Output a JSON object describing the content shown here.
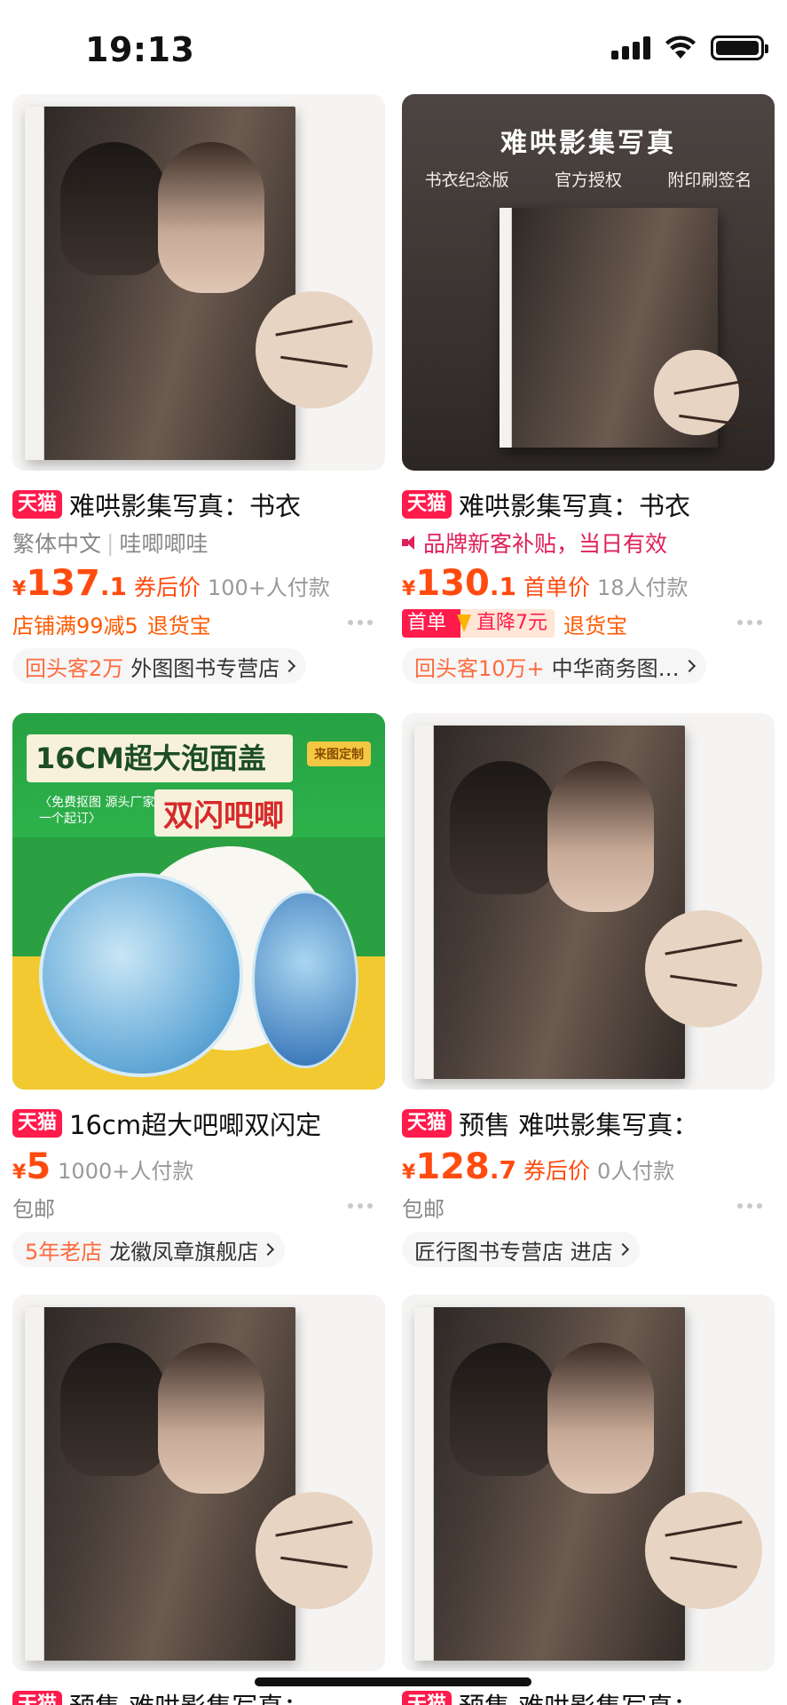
{
  "status_bar": {
    "time": "19:13"
  },
  "products": [
    {
      "tag": "天猫",
      "title": "难哄影集写真：书衣",
      "meta": [
        "繁体中文",
        "哇唧唧哇"
      ],
      "price": {
        "yen": "¥",
        "int": "137",
        "dec": ".1"
      },
      "price_label": "券后价",
      "paid": "100+人付款",
      "extra": [
        "店铺满99减5",
        "退货宝"
      ],
      "shop_tag": "回头客2万",
      "shop": "外图图书专营店"
    },
    {
      "tag": "天猫",
      "title": "难哄影集写真：书衣",
      "promo_line": "品牌新客补贴，当日有效",
      "price": {
        "yen": "¥",
        "int": "130",
        "dec": ".1"
      },
      "price_label": "首单价",
      "paid": "18人付款",
      "first_tag": {
        "a": "首单",
        "b": "直降7元"
      },
      "extra": [
        "退货宝"
      ],
      "shop_tag": "回头客10万+",
      "shop": "中华商务图…",
      "image_text": {
        "title": "难哄影集写真",
        "subs": [
          "书衣纪念版",
          "官方授权",
          "附印刷签名"
        ]
      }
    },
    {
      "tag": "天猫",
      "title": "16cm超大吧唧双闪定",
      "price": {
        "yen": "¥",
        "int": "5",
        "dec": ""
      },
      "price_label": "",
      "paid": "1000+人付款",
      "extra": [
        "包邮"
      ],
      "shop_tag": "5年老店",
      "shop": "龙徽凤章旗舰店",
      "image_text": {
        "head": "16CM超大泡面盖",
        "tag": "来图定制",
        "small1": "〈免费抠图 源头厂家",
        "small2": "一个起订〉",
        "big": "双闪吧唧"
      }
    },
    {
      "tag": "天猫",
      "title": "预售 难哄影集写真：",
      "price": {
        "yen": "¥",
        "int": "128",
        "dec": ".7"
      },
      "price_label": "券后价",
      "paid": "0人付款",
      "extra": [
        "包邮"
      ],
      "shop_tag": "",
      "shop": "匠行图书专营店 进店"
    },
    {
      "tag": "天猫",
      "title": "预售 难哄影集写真："
    },
    {
      "tag": "天猫",
      "title": "预售 难哄影集写真："
    }
  ]
}
